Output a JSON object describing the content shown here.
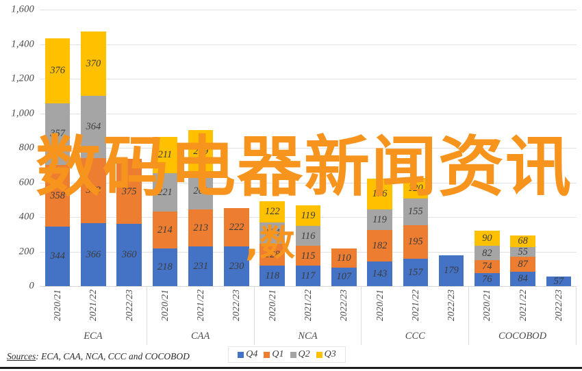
{
  "chart_data": {
    "type": "bar",
    "subtype": "stacked-bar-grouped",
    "title": "",
    "xlabel": "",
    "ylabel": "",
    "ylim": [
      0,
      1600
    ],
    "ytick_step": 200,
    "ytick_labels": [
      "0",
      "200",
      "400",
      "600",
      "800",
      "1,000",
      "1,200",
      "1,400",
      "1,600"
    ],
    "grid": true,
    "legend_position": "bottom-center",
    "series": [
      {
        "name": "Q4",
        "color": "#4472C4"
      },
      {
        "name": "Q1",
        "color": "#ED7D31"
      },
      {
        "name": "Q2",
        "color": "#A5A5A5"
      },
      {
        "name": "Q3",
        "color": "#FFC000"
      }
    ],
    "groups": [
      {
        "name": "ECA",
        "categories": [
          "2020/21",
          "2021/22",
          "2022/23"
        ],
        "bars": [
          {
            "category": "2020/21",
            "values": {
              "Q4": 344,
              "Q1": 358,
              "Q2": 357,
              "Q3": 376
            },
            "total": 1435
          },
          {
            "category": "2021/22",
            "values": {
              "Q4": 366,
              "Q1": 373,
              "Q2": 364,
              "Q3": 370
            },
            "total": 1473
          },
          {
            "category": "2022/23",
            "values": {
              "Q4": 360,
              "Q1": 375,
              "Q2": null,
              "Q3": null
            },
            "total": 735
          }
        ]
      },
      {
        "name": "CAA",
        "categories": [
          "2020/21",
          "2021/22",
          "2022/23"
        ],
        "bars": [
          {
            "category": "2020/21",
            "values": {
              "Q4": 218,
              "Q1": 214,
              "Q2": 221,
              "Q3": 211
            },
            "total": 864
          },
          {
            "category": "2021/22",
            "values": {
              "Q4": 231,
              "Q1": 213,
              "Q2": 209,
              "Q3": 249
            },
            "total": 902
          },
          {
            "category": "2022/23",
            "values": {
              "Q4": 230,
              "Q1": 222,
              "Q2": null,
              "Q3": null
            },
            "total": 452
          }
        ]
      },
      {
        "name": "NCA",
        "categories": [
          "2020/21",
          "2021/22",
          "2022/23"
        ],
        "bars": [
          {
            "category": "2020/21",
            "values": {
              "Q4": 118,
              "Q1": 128,
              "Q2": 124,
              "Q3": 122
            },
            "total": 492
          },
          {
            "category": "2021/22",
            "values": {
              "Q4": 117,
              "Q1": 115,
              "Q2": 116,
              "Q3": 119
            },
            "total": 467
          },
          {
            "category": "2022/23",
            "values": {
              "Q4": 107,
              "Q1": 110,
              "Q2": null,
              "Q3": null
            },
            "total": 217
          }
        ]
      },
      {
        "name": "CCC",
        "categories": [
          "2020/21",
          "2021/22",
          "2022/23"
        ],
        "bars": [
          {
            "category": "2020/21",
            "values": {
              "Q4": 143,
              "Q1": 182,
              "Q2": 119,
              "Q3": 176
            },
            "total": 620
          },
          {
            "category": "2021/22",
            "values": {
              "Q4": 157,
              "Q1": 195,
              "Q2": 155,
              "Q3": 120
            },
            "total": 627
          },
          {
            "category": "2022/23",
            "values": {
              "Q4": 179,
              "Q1": null,
              "Q2": null,
              "Q3": null
            },
            "total": 179
          }
        ]
      },
      {
        "name": "COCOBOD",
        "categories": [
          "2020/21",
          "2021/22",
          "2022/23"
        ],
        "bars": [
          {
            "category": "2020/21",
            "values": {
              "Q4": 76,
              "Q1": 74,
              "Q2": 82,
              "Q3": 90
            },
            "total": 322
          },
          {
            "category": "2021/22",
            "values": {
              "Q4": 84,
              "Q1": 87,
              "Q2": 55,
              "Q3": 68
            },
            "total": 294
          },
          {
            "category": "2022/23",
            "values": {
              "Q4": 57,
              "Q1": null,
              "Q2": null,
              "Q3": null
            },
            "total": 57
          }
        ]
      }
    ]
  },
  "legend": {
    "items": [
      {
        "label": "Q4",
        "color": "#4472C4"
      },
      {
        "label": "Q1",
        "color": "#ED7D31"
      },
      {
        "label": "Q2",
        "color": "#A5A5A5"
      },
      {
        "label": "Q3",
        "color": "#FFC000"
      }
    ]
  },
  "source": {
    "prefix": "Sources",
    "text": ": ECA, CAA, NCA, CCC and COCOBOD"
  },
  "watermark": {
    "main": "数码电器新闻资讯",
    "sub": ",数",
    "color": "#F7941E"
  }
}
